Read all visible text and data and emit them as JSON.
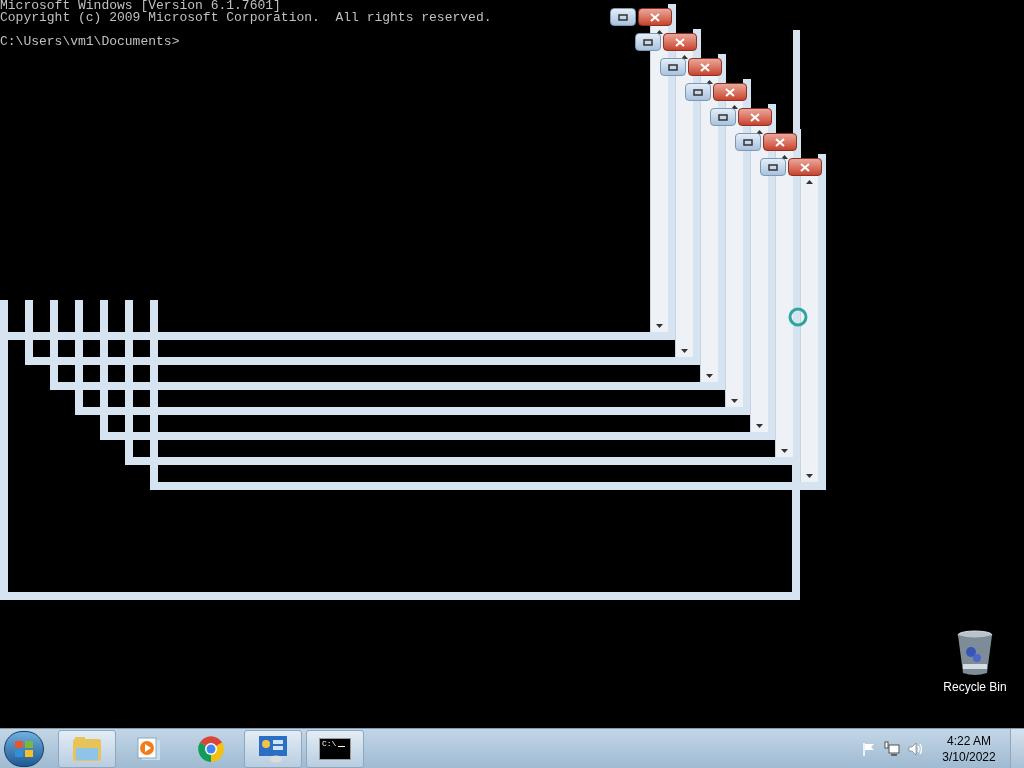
{
  "console": {
    "header": [
      "Microsoft Windows [Version 6.1.7601]",
      "Copyright (c) 2009 Microsoft Corporation.  All rights reserved."
    ],
    "prompt": "C:\\Users\\vm1\\Documents>"
  },
  "desktop_icons": [
    {
      "label": "Recycle Bin"
    }
  ],
  "taskbar": {
    "items": [
      {
        "kind": "folder",
        "running": true
      },
      {
        "kind": "media",
        "running": false
      },
      {
        "kind": "browser",
        "running": false
      },
      {
        "kind": "control-panel",
        "running": true
      },
      {
        "kind": "console",
        "running": true,
        "icon_text": "C:\\"
      }
    ],
    "time": "4:22 AM",
    "date": "3/10/2022"
  }
}
